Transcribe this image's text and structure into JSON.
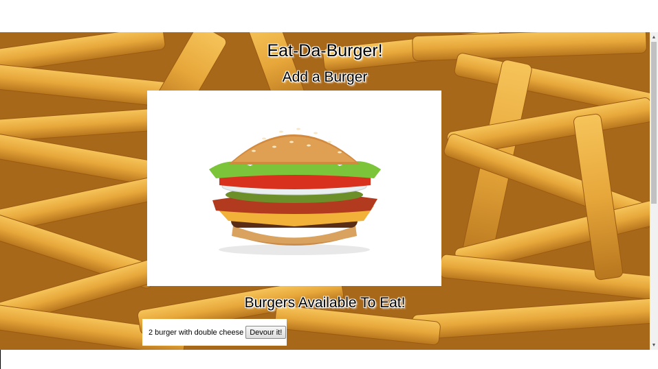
{
  "header": {
    "title": "Eat-Da-Burger!",
    "add_heading": "Add a Burger",
    "available_heading": "Burgers Available To Eat!"
  },
  "burgers": [
    {
      "name": "2 burger with double cheese",
      "button_label": "Devour it!"
    }
  ],
  "colors": {
    "background_fries": "#d89a34",
    "card": "#ffffff"
  },
  "icons": {
    "scroll_up": "scroll-up-arrow-icon",
    "scroll_down": "scroll-down-arrow-icon"
  }
}
